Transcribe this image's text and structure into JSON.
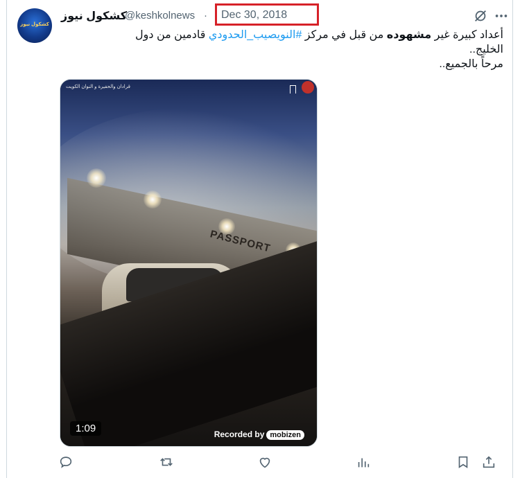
{
  "tweet": {
    "display_name": "كشكول نيوز",
    "handle": "@keshkolnews",
    "separator": "·",
    "date": "Dec 30, 2018",
    "avatar_text": "كشكول نيوز",
    "text_line1_before_bold": "أعداد كبيرة غير ",
    "text_bold": "مشهوده",
    "text_line1_after_bold": " من قبل في مركز ",
    "hashtag": "#النويصيب_الحدودي",
    "text_line1_end": " قادمين من دول",
    "text_line2": "الخليج..",
    "text_line3": "مرحاً بالجميع.."
  },
  "media": {
    "overlay_caption": "قرادان والحفيرة و النوان الكويت",
    "sign_text": "PASSPORT",
    "duration": "1:09",
    "recorded_label": "Recorded by",
    "recorded_brand": "mobizen"
  },
  "icons": {
    "grok": "grok-icon",
    "more": "more-icon",
    "reply": "reply-icon",
    "retweet": "retweet-icon",
    "like": "heart-icon",
    "views": "views-icon",
    "bookmark": "bookmark-icon",
    "share": "share-icon"
  },
  "colors": {
    "link": "#1d9bf0",
    "secondary": "#536471",
    "highlight_box": "#d62128"
  }
}
